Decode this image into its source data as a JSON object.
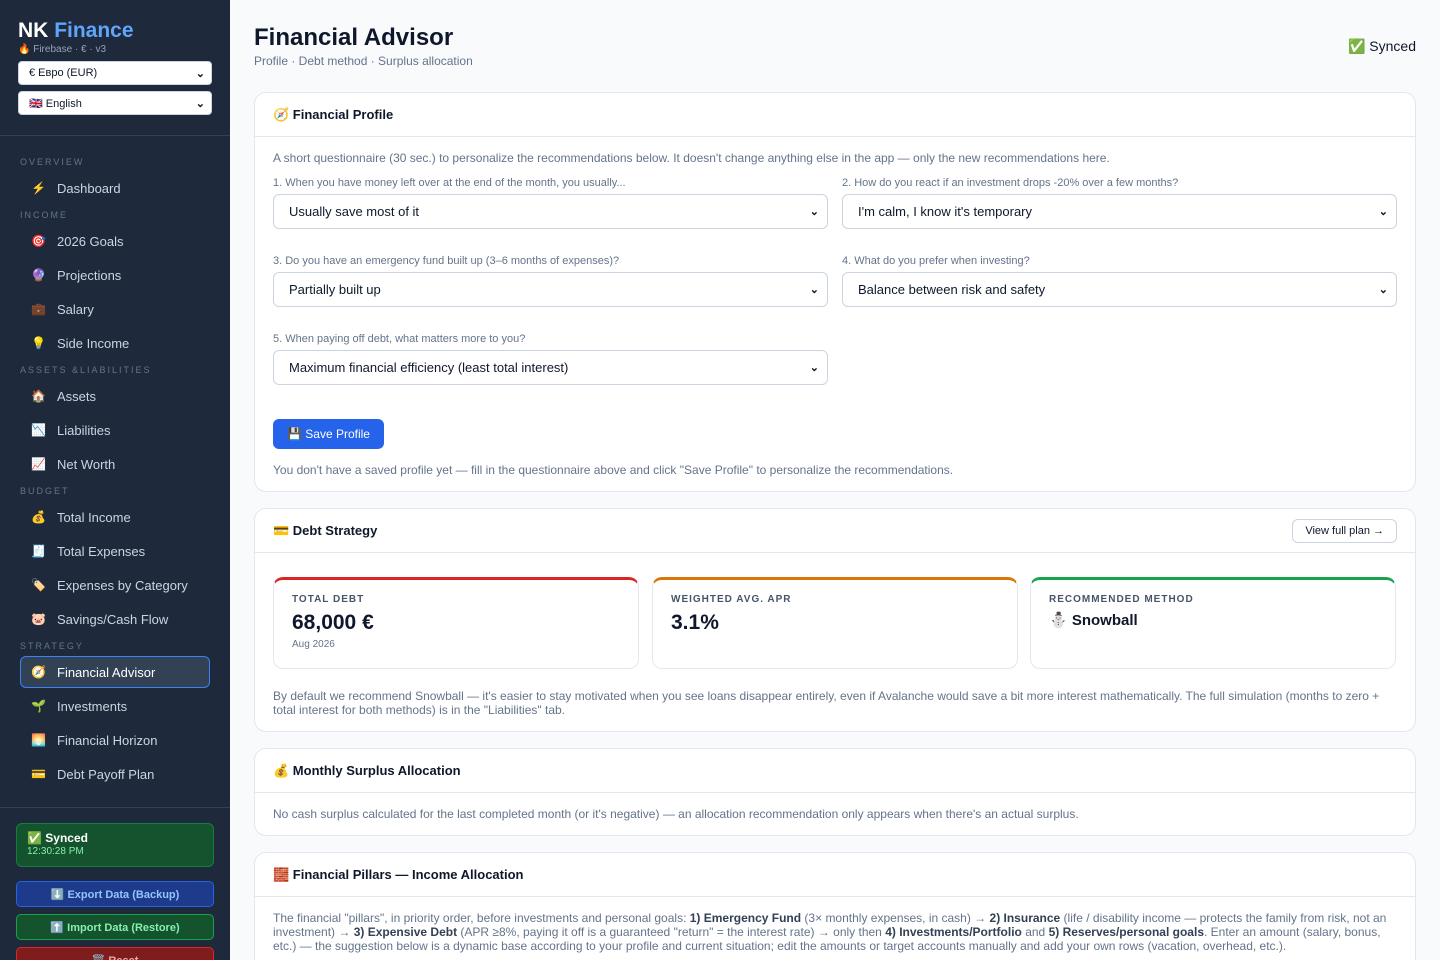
{
  "sidebar": {
    "brand_prefix": "NK",
    "brand_accent": "Finance",
    "brand_sub": "🔥 Firebase · € · v3",
    "currency": "€ Евро (EUR)",
    "language": "🇬🇧 English",
    "sections": {
      "overview": "OVERVIEW",
      "income": "INCOME",
      "assets": "ASSETS &LIABILITIES",
      "budget": "BUDGET",
      "strategy": "STRATEGY"
    },
    "items": {
      "dashboard": {
        "icon": "⚡",
        "label": "Dashboard"
      },
      "goals": {
        "icon": "🎯",
        "label": "2026 Goals"
      },
      "projections": {
        "icon": "🔮",
        "label": "Projections"
      },
      "salary": {
        "icon": "💼",
        "label": "Salary"
      },
      "side_income": {
        "icon": "💡",
        "label": "Side Income"
      },
      "assets": {
        "icon": "🏠",
        "label": "Assets"
      },
      "liabilities": {
        "icon": "📉",
        "label": "Liabilities"
      },
      "net_worth": {
        "icon": "📈",
        "label": "Net Worth"
      },
      "total_income": {
        "icon": "💰",
        "label": "Total Income"
      },
      "total_expenses": {
        "icon": "🧾",
        "label": "Total Expenses"
      },
      "expenses_by_category": {
        "icon": "🏷️",
        "label": "Expenses by Category"
      },
      "savings": {
        "icon": "🐷",
        "label": "Savings/Cash Flow"
      },
      "financial_advisor": {
        "icon": "🧭",
        "label": "Financial Advisor"
      },
      "investments": {
        "icon": "🌱",
        "label": "Investments"
      },
      "financial_horizon": {
        "icon": "🌅",
        "label": "Financial Horizon"
      },
      "debt_payoff": {
        "icon": "💳",
        "label": "Debt Payoff Plan"
      }
    },
    "sync": {
      "title": "✅ Synced",
      "time": "12:30:28 PM"
    },
    "export_label": "⬇️ Export Data (Backup)",
    "import_label": "⬆️ Import Data (Restore)",
    "reset_label": "🗑️ Reset"
  },
  "header": {
    "title": "Financial Advisor",
    "subtitle": "Profile · Debt method · Surplus allocation",
    "status": "✅ Synced"
  },
  "profile": {
    "title": "🧭 Financial Profile",
    "intro": "A short questionnaire (30 sec.) to personalize the recommendations below. It doesn't change anything else in the app — only the new recommendations here.",
    "questions": [
      {
        "label": "1. When you have money left over at the end of the month, you usually...",
        "value": "Usually save most of it"
      },
      {
        "label": "2. How do you react if an investment drops -20% over a few months?",
        "value": "I'm calm, I know it's temporary"
      },
      {
        "label": "3. Do you have an emergency fund built up (3–6 months of expenses)?",
        "value": "Partially built up"
      },
      {
        "label": "4. What do you prefer when investing?",
        "value": "Balance between risk and safety"
      },
      {
        "label": "5. When paying off debt, what matters more to you?",
        "value": "Maximum financial efficiency (least total interest)"
      }
    ],
    "save_label": "💾 Save Profile",
    "note": "You don't have a saved profile yet — fill in the questionnaire above and click \"Save Profile\" to personalize the recommendations."
  },
  "debt": {
    "title": "💳 Debt Strategy",
    "view_plan": "View full plan →",
    "stats": [
      {
        "key": "TOTAL DEBT",
        "value": "68,000 €",
        "detail": "Aug 2026",
        "color": "#dc2626"
      },
      {
        "key": "WEIGHTED AVG. APR",
        "value": "3.1%",
        "detail": "",
        "color": "#d97706"
      },
      {
        "key": "RECOMMENDED METHOD",
        "value": "⛄ Snowball",
        "detail": "",
        "color": "#16a34a"
      }
    ],
    "note": "By default we recommend Snowball — it's easier to stay motivated when you see loans disappear entirely, even if Avalanche would save a bit more interest mathematically. The full simulation (months to zero + total interest for both methods) is in the \"Liabilities\" tab."
  },
  "surplus": {
    "title": "💰 Monthly Surplus Allocation",
    "note": "No cash surplus calculated for the last completed month (or it's negative) — an allocation recommendation only appears when there's an actual surplus."
  },
  "pillars": {
    "title": "🧱 Financial Pillars — Income Allocation",
    "p1": "The financial \"pillars\", in priority order, before investments and personal goals: ",
    "b1": "1) Emergency Fund",
    "p2": " (3× monthly expenses, in cash) → ",
    "b2": "2) Insurance",
    "p3": " (life / disability income — protects the family from risk, not an investment) → ",
    "b3": "3) Expensive Debt",
    "p4": " (APR ≥8%, paying it off is a guaranteed \"return\" = the interest rate) → only then ",
    "b4": "4) Investments/Portfolio",
    "p5": " and ",
    "b5": "5) Reserves/personal goals",
    "p6": ". Enter an amount (salary, bonus, etc.) — the suggestion below is a dynamic base according to your profile and current situation; edit the amounts or target accounts manually and add your own rows (vacation, overhead, etc.)."
  }
}
